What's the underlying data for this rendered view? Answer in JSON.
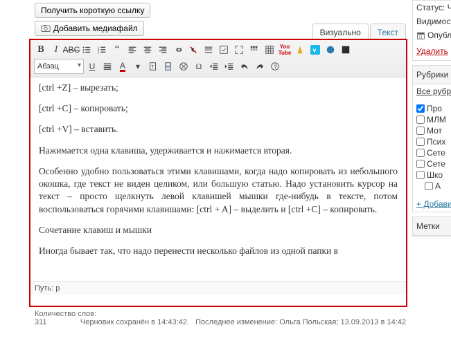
{
  "topButtons": {
    "shortlink": "Получить короткую ссылку",
    "media": "Добавить медиафайл"
  },
  "tabs": {
    "visual": "Визуально",
    "text": "Текст"
  },
  "formatSelect": "Абзац",
  "content": {
    "p1": "[ctrl +Z] – вырезать;",
    "p2": "[ctrl +C] – копировать;",
    "p3": "[ctrl +V] – вставить.",
    "p4": "Нажимается одна клавиша, удерживается и нажимается вторая.",
    "p5": "Особенно удобно пользоваться этими клавишами, когда надо копировать из небольшого окошка, где текст не виден целиком, или большую статью. Надо установить курсор на текст – просто щелкнуть левой клавишей мышки где-нибудь в тексте, потом воспользоваться горячими клавишами: [ctrl + A] – выделить и [ctrl +C] – копировать.",
    "p6": "Сочетание клавиш и мышки",
    "p7": "Иногда бывает так, что надо перенести несколько файлов из одной папки в"
  },
  "path": "Путь: p",
  "info": {
    "words_label": "Количество слов:",
    "words_val": "311",
    "draft": "Черновик сохранён в 14:43:42.",
    "last_edit": "Последнее изменение: Ольга Польская; 13.09.2013 в 14:42"
  },
  "sidebar": {
    "status": "Статус: Че",
    "visibility": "Видимост",
    "publish": "Опубл",
    "delete": "Удалить",
    "rubriki_head": "Рубрики",
    "rubriki_tab": "Все рубр",
    "cats": {
      "c1": "Про",
      "c2": "МЛМ",
      "c3": "Мот",
      "c4": "Псих",
      "c5": "Сете",
      "c6": "Сете",
      "c7": "Шко",
      "c8": "А"
    },
    "checked": {
      "c1": true
    },
    "add": "+ Добави",
    "tags_head": "Метки"
  }
}
